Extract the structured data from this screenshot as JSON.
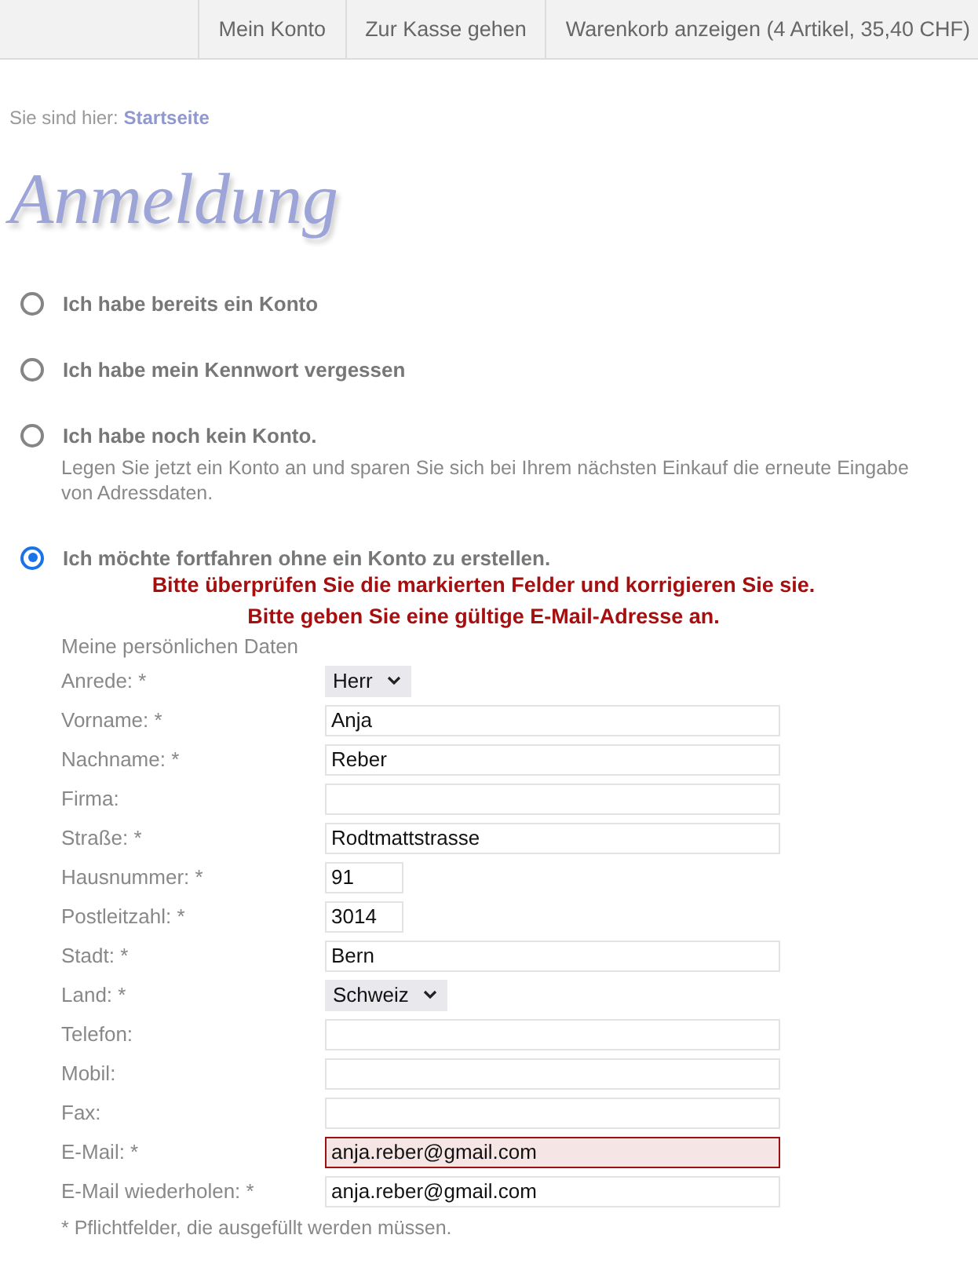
{
  "nav": [
    {
      "label": "Mein Konto"
    },
    {
      "label": "Zur Kasse gehen"
    },
    {
      "label": "Warenkorb anzeigen (4 Artikel, 35,40 CHF)"
    }
  ],
  "breadcrumb": {
    "prefix": "Sie sind hier:",
    "link": "Startseite"
  },
  "title": "Anmeldung",
  "options": [
    {
      "label": "Ich habe bereits ein Konto",
      "selected": false
    },
    {
      "label": "Ich habe mein Kennwort vergessen",
      "selected": false
    },
    {
      "label": "Ich habe noch kein Konto.",
      "selected": false,
      "description": "Legen Sie jetzt ein Konto an und sparen Sie sich bei Ihrem nächsten Einkauf die erneute Eingabe von Adressdaten."
    },
    {
      "label": "Ich möchte fortfahren ohne ein Konto zu erstellen.",
      "selected": true
    }
  ],
  "errors": [
    "Bitte überprüfen Sie die markierten Felder und korrigieren Sie sie.",
    "Bitte geben Sie eine gültige E-Mail-Adresse an."
  ],
  "form": {
    "heading": "Meine persönlichen Daten",
    "fields": [
      {
        "label": "Anrede: *",
        "kind": "select",
        "value": "Herr"
      },
      {
        "label": "Vorname: *",
        "kind": "text",
        "value": "Anja"
      },
      {
        "label": "Nachname: *",
        "kind": "text",
        "value": "Reber"
      },
      {
        "label": "Firma:",
        "kind": "text"
      },
      {
        "label": "Straße: *",
        "kind": "text",
        "value": "Rodtmattstrasse"
      },
      {
        "label": "Hausnummer: *",
        "kind": "short",
        "value": "91"
      },
      {
        "label": "Postleitzahl: *",
        "kind": "short",
        "value": "3014"
      },
      {
        "label": "Stadt: *",
        "kind": "text",
        "value": "Bern"
      },
      {
        "label": "Land: *",
        "kind": "select",
        "value": "Schweiz"
      },
      {
        "label": "Telefon:",
        "kind": "text"
      },
      {
        "label": "Mobil:",
        "kind": "text"
      },
      {
        "label": "Fax:",
        "kind": "text"
      },
      {
        "label": "E-Mail: *",
        "kind": "text",
        "value": "anja.reber@gmail.com",
        "invalid": true
      },
      {
        "label": "E-Mail wiederholen: *",
        "kind": "text",
        "value": "anja.reber@gmail.com"
      }
    ],
    "footnote": "* Pflichtfelder, die ausgefüllt werden müssen."
  }
}
